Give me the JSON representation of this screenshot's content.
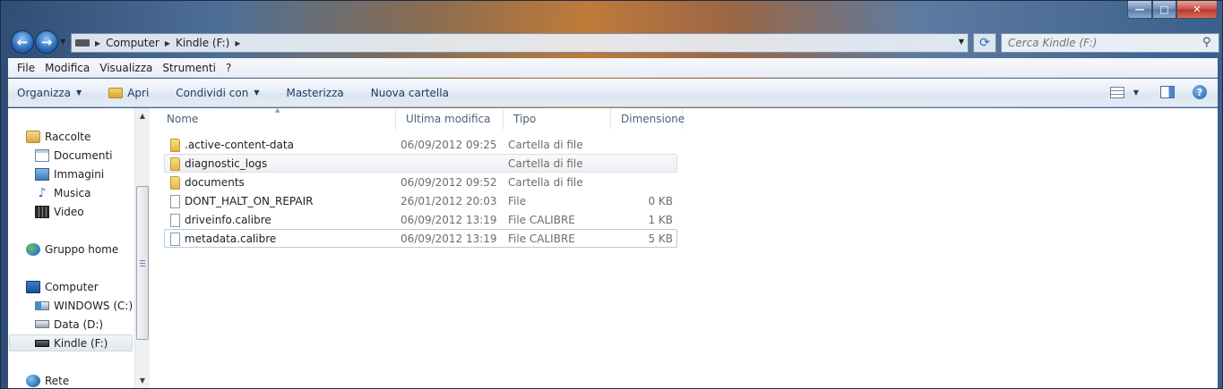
{
  "window": {
    "minimize_glyph": "—",
    "maximize_glyph": "□",
    "close_glyph": "✕"
  },
  "address_bar": {
    "crumbs": [
      "Computer",
      "Kindle (F:)"
    ],
    "search_placeholder": "Cerca Kindle (F:)"
  },
  "menu": [
    "File",
    "Modifica",
    "Visualizza",
    "Strumenti",
    "?"
  ],
  "toolbar": {
    "organizza": "Organizza",
    "apri": "Apri",
    "condividi": "Condividi con",
    "masterizza": "Masterizza",
    "nuova_cartella": "Nuova cartella"
  },
  "nav": {
    "raccolte": "Raccolte",
    "documenti": "Documenti",
    "immagini": "Immagini",
    "musica": "Musica",
    "video": "Video",
    "gruppo_home": "Gruppo home",
    "computer": "Computer",
    "windows": "WINDOWS (C:)",
    "data": "Data (D:)",
    "kindle": "Kindle (F:)",
    "rete": "Rete"
  },
  "columns": {
    "name": "Nome",
    "modified": "Ultima modifica",
    "type": "Tipo",
    "size": "Dimensione"
  },
  "files": [
    {
      "name": ".active-content-data",
      "modified": "06/09/2012 09:25",
      "type": "Cartella di file",
      "size": "",
      "kind": "folder"
    },
    {
      "name": "diagnostic_logs",
      "modified": "",
      "type": "Cartella di file",
      "size": "",
      "kind": "folder"
    },
    {
      "name": "documents",
      "modified": "06/09/2012 09:52",
      "type": "Cartella di file",
      "size": "",
      "kind": "folder"
    },
    {
      "name": "DONT_HALT_ON_REPAIR",
      "modified": "26/01/2012 20:03",
      "type": "File",
      "size": "0 KB",
      "kind": "file"
    },
    {
      "name": "driveinfo.calibre",
      "modified": "06/09/2012 13:19",
      "type": "File CALIBRE",
      "size": "1 KB",
      "kind": "file"
    },
    {
      "name": "metadata.calibre",
      "modified": "06/09/2012 13:19",
      "type": "File CALIBRE",
      "size": "5 KB",
      "kind": "file"
    }
  ]
}
